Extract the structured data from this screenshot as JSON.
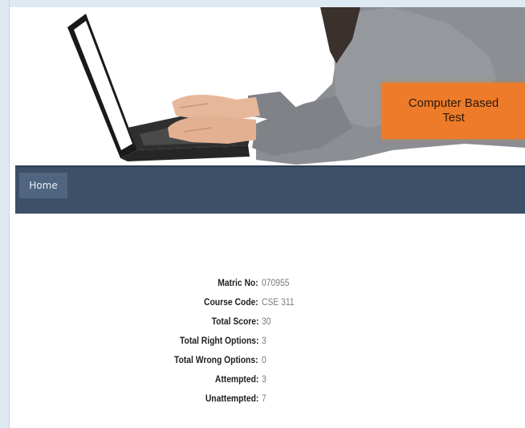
{
  "banner": {
    "badge_line1": "Computer Based",
    "badge_line2": "Test"
  },
  "nav": {
    "items": [
      {
        "label": "Home"
      }
    ]
  },
  "result": {
    "rows": [
      {
        "label": "Matric No:",
        "value": "070955"
      },
      {
        "label": "Course Code:",
        "value": "CSE 311"
      },
      {
        "label": "Total Score:",
        "value": "30"
      },
      {
        "label": "Total Right Options:",
        "value": "3"
      },
      {
        "label": "Total Wrong Options:",
        "value": "0"
      },
      {
        "label": "Attempted:",
        "value": "3"
      },
      {
        "label": "Unattempted:",
        "value": "7"
      }
    ]
  },
  "colors": {
    "nav_bar": "#3d5068",
    "nav_button": "#4f6580",
    "badge": "#ee7b2a",
    "frame": "#dfe9f2"
  }
}
